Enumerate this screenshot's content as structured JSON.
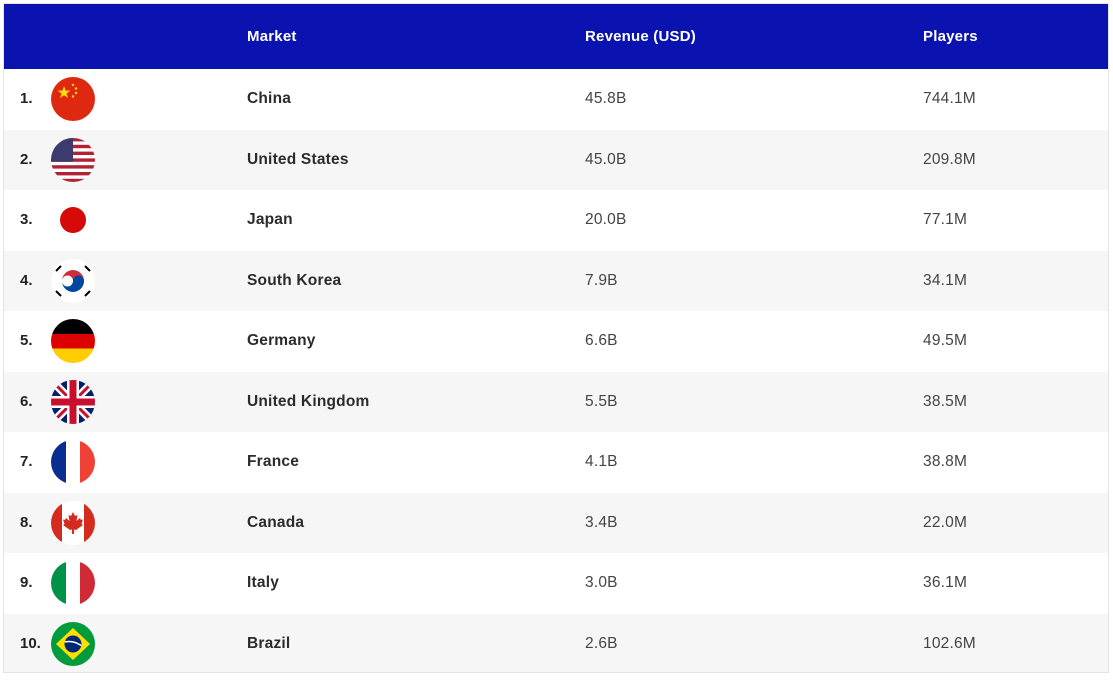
{
  "header": {
    "market": "Market",
    "revenue": "Revenue (USD)",
    "players": "Players"
  },
  "rows": [
    {
      "rank": "1.",
      "flag": "china-flag-icon",
      "market": "China",
      "revenue": "45.8B",
      "players": "744.1M"
    },
    {
      "rank": "2.",
      "flag": "united-states-flag-icon",
      "market": "United States",
      "revenue": "45.0B",
      "players": "209.8M"
    },
    {
      "rank": "3.",
      "flag": "japan-flag-icon",
      "market": "Japan",
      "revenue": "20.0B",
      "players": "77.1M"
    },
    {
      "rank": "4.",
      "flag": "south-korea-flag-icon",
      "market": "South Korea",
      "revenue": "7.9B",
      "players": "34.1M"
    },
    {
      "rank": "5.",
      "flag": "germany-flag-icon",
      "market": "Germany",
      "revenue": "6.6B",
      "players": "49.5M"
    },
    {
      "rank": "6.",
      "flag": "united-kingdom-flag-icon",
      "market": "United Kingdom",
      "revenue": "5.5B",
      "players": "38.5M"
    },
    {
      "rank": "7.",
      "flag": "france-flag-icon",
      "market": "France",
      "revenue": "4.1B",
      "players": "38.8M"
    },
    {
      "rank": "8.",
      "flag": "canada-flag-icon",
      "market": "Canada",
      "revenue": "3.4B",
      "players": "22.0M"
    },
    {
      "rank": "9.",
      "flag": "italy-flag-icon",
      "market": "Italy",
      "revenue": "3.0B",
      "players": "36.1M"
    },
    {
      "rank": "10.",
      "flag": "brazil-flag-icon",
      "market": "Brazil",
      "revenue": "2.6B",
      "players": "102.6M"
    }
  ],
  "colors": {
    "header_bg": "#0a13b0",
    "alt_row": "#f6f6f7"
  }
}
